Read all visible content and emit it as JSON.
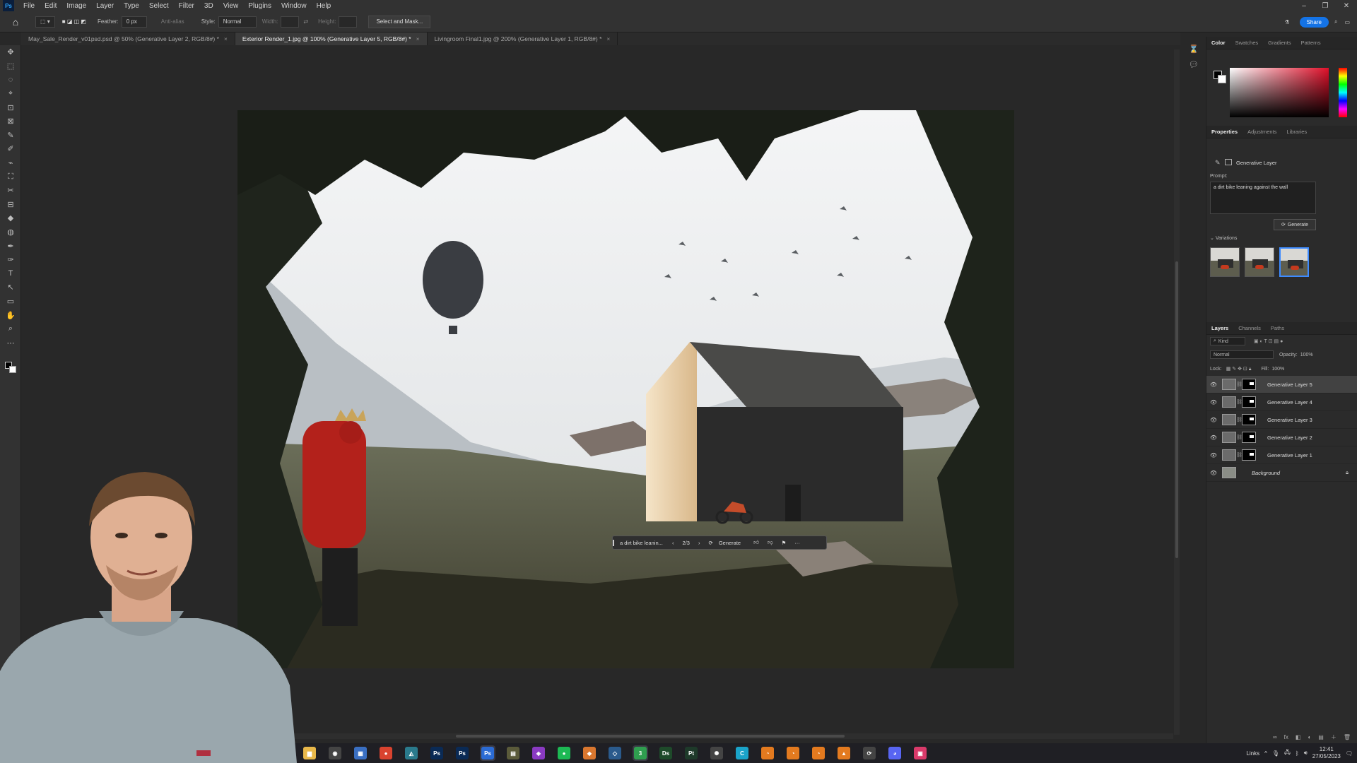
{
  "app": {
    "logo": "Ps"
  },
  "menu": [
    "File",
    "Edit",
    "Image",
    "Layer",
    "Type",
    "Select",
    "Filter",
    "3D",
    "View",
    "Plugins",
    "Window",
    "Help"
  ],
  "window_controls": [
    "–",
    "❐",
    "✕"
  ],
  "options": {
    "feather_label": "Feather:",
    "feather_value": "0 px",
    "antialias": "Anti-alias",
    "style_label": "Style:",
    "style_value": "Normal",
    "width_label": "Width:",
    "height_label": "Height:",
    "select_mask": "Select and Mask...",
    "share": "Share"
  },
  "tabs": [
    {
      "label": "May_Sale_Render_v01psd.psd @ 50% (Generative Layer 2, RGB/8#) *",
      "active": false
    },
    {
      "label": "Exterior Render_1.jpg @ 100% (Generative Layer 5, RGB/8#) *",
      "active": true
    },
    {
      "label": "Livingroom Final1.jpg @ 200% (Generative Layer 1, RGB/8#) *",
      "active": false
    }
  ],
  "tools": [
    "✥",
    "⬚",
    "◌",
    "⌖",
    "⊡",
    "⊠",
    "✎",
    "✐",
    "⌁",
    "⛶",
    "✂",
    "⊟",
    "◆",
    "◍",
    "✒",
    "T",
    "↖",
    "▭",
    "✋",
    "⌕",
    "⋯"
  ],
  "contextual_bar": {
    "prompt": "a dirt bike leanin...",
    "counter": "2/3",
    "generate": "Generate",
    "more": "···"
  },
  "color_panel": {
    "tabs": [
      "Color",
      "Swatches",
      "Gradients",
      "Patterns"
    ],
    "active": "Color",
    "fg": "#000000",
    "bg": "#ffffff",
    "accent": "#e0102a"
  },
  "properties": {
    "tabs": [
      "Properties",
      "Adjustments",
      "Libraries"
    ],
    "active": "Properties",
    "layer_type": "Generative Layer",
    "prompt_label": "Prompt:",
    "prompt_text": "a dirt bike leaning against the wall",
    "generate": "Generate",
    "variations_label": "Variations",
    "variation_count": 3,
    "selected_variation": 3
  },
  "layers_panel": {
    "tabs": [
      "Layers",
      "Channels",
      "Paths"
    ],
    "active": "Layers",
    "kind": "Kind",
    "blend": "Normal",
    "opacity_label": "Opacity:",
    "opacity": "100%",
    "lock_label": "Lock:",
    "fill_label": "Fill:",
    "fill": "100%",
    "layers": [
      {
        "name": "Generative Layer 5",
        "active": true
      },
      {
        "name": "Generative Layer 4",
        "active": false
      },
      {
        "name": "Generative Layer 3",
        "active": false
      },
      {
        "name": "Generative Layer 2",
        "active": false
      },
      {
        "name": "Generative Layer 1",
        "active": false
      }
    ],
    "background": "Background",
    "bottom_icons": [
      "∞",
      "fx",
      "◧",
      "◐",
      "▤",
      "＋",
      "🗑"
    ]
  },
  "taskbar": {
    "apps": [
      {
        "icon": "folder-icon",
        "glyph": "▆",
        "color": "#e8b84a"
      },
      {
        "icon": "obs-icon",
        "glyph": "◉",
        "color": "#444"
      },
      {
        "icon": "calculator-icon",
        "glyph": "▦",
        "color": "#3a6fc2"
      },
      {
        "icon": "chrome-icon",
        "glyph": "●",
        "color": "#d9432f"
      },
      {
        "icon": "app-icon",
        "glyph": "◭",
        "color": "#2a7a8c"
      },
      {
        "icon": "photoshop-icon",
        "glyph": "Ps",
        "color": "#0a2a55"
      },
      {
        "icon": "photoshop-beta-icon",
        "glyph": "Ps",
        "color": "#0a2a55"
      },
      {
        "icon": "photoshop-active-icon",
        "glyph": "Ps",
        "color": "#2b6bd4",
        "active": true
      },
      {
        "icon": "notes-icon",
        "glyph": "▤",
        "color": "#5a5a3a"
      },
      {
        "icon": "affinity-icon",
        "glyph": "◈",
        "color": "#8a3ac2"
      },
      {
        "icon": "spotify-icon",
        "glyph": "●",
        "color": "#1db954"
      },
      {
        "icon": "box-icon",
        "glyph": "◆",
        "color": "#d9772f"
      },
      {
        "icon": "sketchup-icon",
        "glyph": "◇",
        "color": "#2a5a8c"
      },
      {
        "icon": "ds-icon",
        "glyph": "3",
        "color": "#2f9e4f",
        "active": true
      },
      {
        "icon": "dimension-icon",
        "glyph": "Ds",
        "color": "#1e4a2a"
      },
      {
        "icon": "painter-icon",
        "glyph": "Pt",
        "color": "#1e3a2a"
      },
      {
        "icon": "settings-icon",
        "glyph": "✺",
        "color": "#444"
      },
      {
        "icon": "cinema-icon",
        "glyph": "C",
        "color": "#1aa3c9"
      },
      {
        "icon": "blender-icon",
        "glyph": "◔",
        "color": "#e37a1f"
      },
      {
        "icon": "blender2-icon",
        "glyph": "◔",
        "color": "#e37a1f"
      },
      {
        "icon": "blender3-icon",
        "glyph": "◔",
        "color": "#e37a1f"
      },
      {
        "icon": "vlc-icon",
        "glyph": "▲",
        "color": "#e37a1f"
      },
      {
        "icon": "sync-icon",
        "glyph": "⟳",
        "color": "#444"
      },
      {
        "icon": "discord-icon",
        "glyph": "◕",
        "color": "#5865f2"
      },
      {
        "icon": "gallery-icon",
        "glyph": "▣",
        "color": "#d93a6a"
      }
    ],
    "tray_links": "Links",
    "time": "12:41",
    "date": "27/05/2023"
  }
}
